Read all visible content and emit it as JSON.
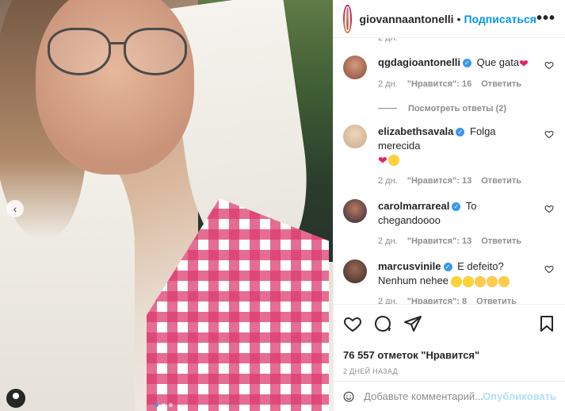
{
  "post": {
    "author": "giovannaantonelli",
    "follow_label": "Подписаться",
    "separator": "•",
    "more_label": "•••"
  },
  "comments": {
    "cut_time": "2 дн.",
    "items": [
      {
        "username": "qgdagioantonelli",
        "text": "Que gata",
        "emoji": [
          "❤"
        ],
        "time": "2 дн.",
        "likes": "\"Нравится\": 16",
        "reply": "Ответить",
        "avatar_color": "#8a4b3a"
      },
      {
        "username": "elizabethsavala",
        "text": "Folga merecida",
        "emoji": [
          "❤",
          "😍"
        ],
        "time": "2 дн.",
        "likes": "\"Нравится\": 13",
        "reply": "Ответить",
        "avatar_color": "#c9a98a"
      },
      {
        "username": "carolmarrareal",
        "text": "To chegandoooo",
        "emoji": [],
        "time": "2 дн.",
        "likes": "\"Нравится\": 13",
        "reply": "Ответить",
        "avatar_color": "#2f2a3a"
      },
      {
        "username": "marcusvinile",
        "text": "E defeito? Nenhum nehee",
        "emoji": [
          "😍",
          "😍",
          "👏",
          "👏",
          "👏"
        ],
        "time": "2 дн.",
        "likes": "\"Нравится\": 8",
        "reply": "Ответить",
        "avatar_color": "#3a2a26"
      }
    ],
    "view_replies": "Посмотреть ответы (2)"
  },
  "actions": {
    "likes": "76 557 отметок \"Нравится\"",
    "date": "2 ДНЕЙ НАЗАД"
  },
  "add_comment": {
    "placeholder": "Добавьте комментарий...",
    "publish": "Опубликовать"
  },
  "colors": {
    "accent": "#0095f6",
    "verified": "#3897f0",
    "muted": "#8e8e8e"
  },
  "icons": [
    "heart-icon",
    "comment-icon",
    "share-icon",
    "bookmark-icon",
    "smile-icon",
    "more-icon",
    "verified-icon",
    "chevron-left-icon"
  ]
}
